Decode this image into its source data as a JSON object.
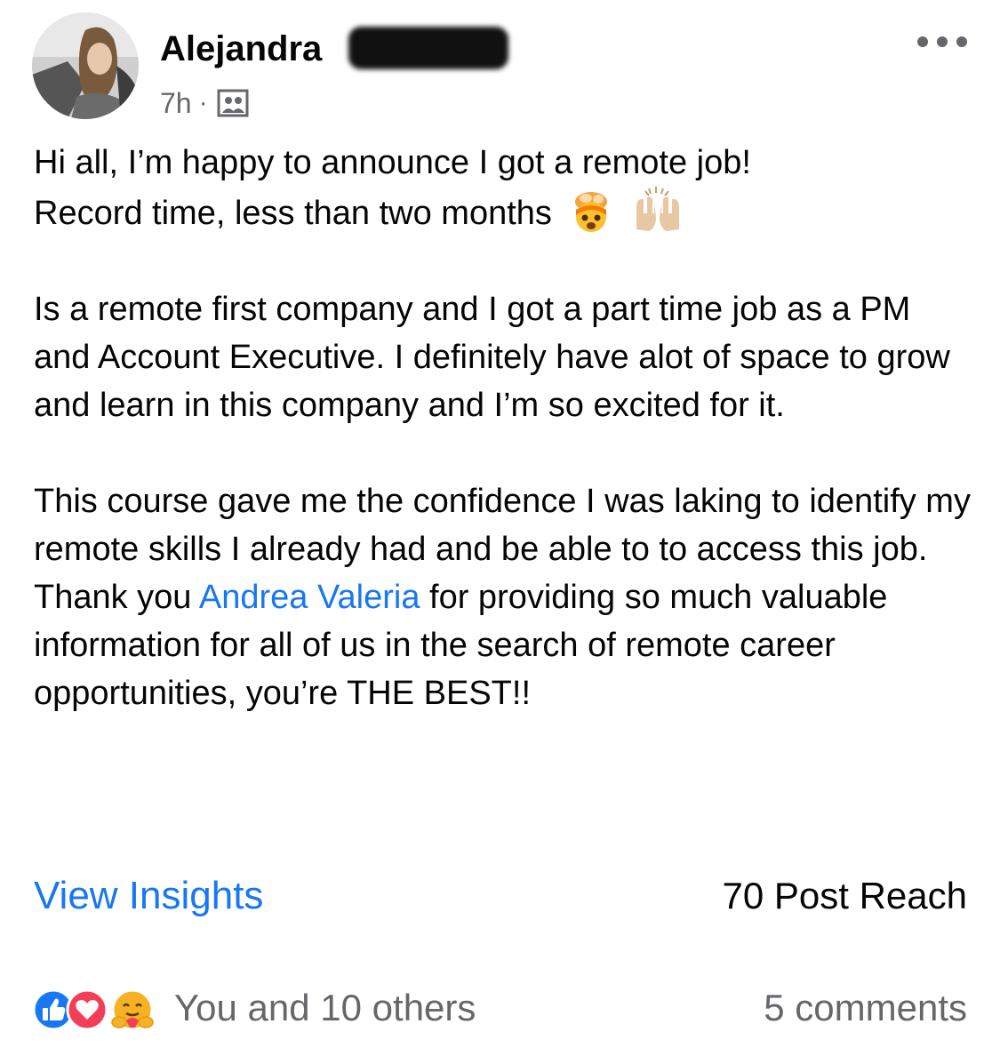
{
  "author": {
    "name": "Alejandra"
  },
  "meta": {
    "time": "7h",
    "separator": "·",
    "audience_icon": "group-icon"
  },
  "menu": {
    "icon": "more-horizontal-icon"
  },
  "post": {
    "para1_line1": "Hi all, I’m happy to announce I got a remote job!",
    "para1_line2": "Record time, less than two months",
    "para1_emojis": [
      "exploding-head-emoji",
      "raising-hands-emoji"
    ],
    "para2": "Is a remote first company and I got a part time job as a PM and Account Executive. I definitely have alot of space to grow and learn in this company and I’m so excited for it.",
    "para3_before_mention": "This course gave me the confidence I was laking to identify my remote skills I already had and be able to to access this job. Thank you ",
    "mention": "Andrea Valeria",
    "para3_after_mention": " for providing so much valuable information for all of us in the search of remote career opportunities, you’re THE BEST!!"
  },
  "insights": {
    "view_insights_label": "View Insights",
    "post_reach": "70 Post Reach"
  },
  "reactions": {
    "icons": [
      "like-icon",
      "love-icon",
      "care-icon"
    ],
    "summary": "You and 10 others",
    "comments": "5 comments"
  },
  "colors": {
    "link_blue": "#1877f2",
    "secondary_text": "#65676b",
    "like_blue": "#1877f2",
    "love_red": "#f33e58",
    "care_yellow": "#f7b125"
  }
}
